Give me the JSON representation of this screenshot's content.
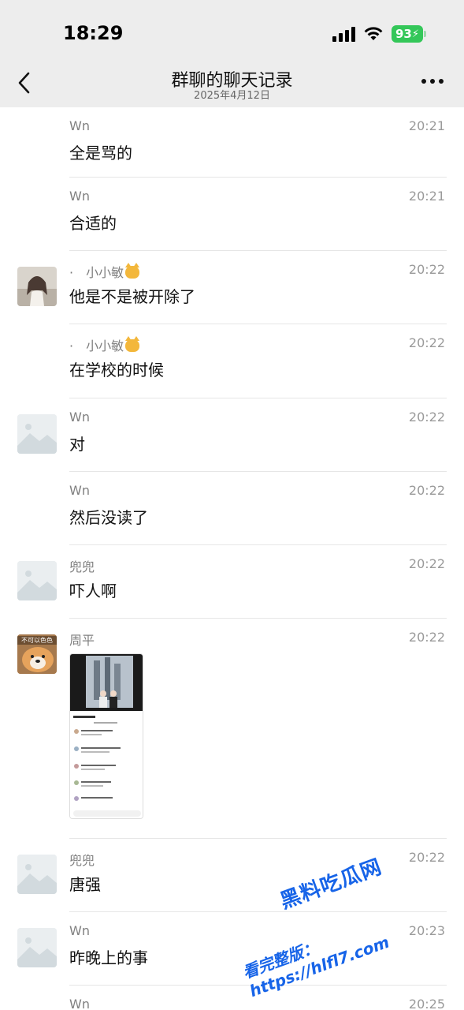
{
  "status_bar": {
    "time": "18:29",
    "battery": "93"
  },
  "nav": {
    "title": "群聊的聊天记录",
    "subtitle": "2025年4月12日"
  },
  "messages": [
    {
      "sender": "Wn",
      "time": "20:21",
      "text": "全是骂的",
      "avatar": "none"
    },
    {
      "sender": "Wn",
      "time": "20:21",
      "text": "合适的",
      "avatar": "none"
    },
    {
      "sender": "小小敏",
      "time": "20:22",
      "text": "他是不是被开除了",
      "avatar": "photo-girl",
      "prefix": "·"
    },
    {
      "sender": "小小敏",
      "time": "20:22",
      "text": "在学校的时候",
      "avatar": "none",
      "prefix": "·"
    },
    {
      "sender": "Wn",
      "time": "20:22",
      "text": "对",
      "avatar": "placeholder"
    },
    {
      "sender": "Wn",
      "time": "20:22",
      "text": "然后没读了",
      "avatar": "none"
    },
    {
      "sender": "兜兜",
      "time": "20:22",
      "text": "吓人啊",
      "avatar": "placeholder"
    },
    {
      "sender": "周平",
      "time": "20:22",
      "text": "",
      "avatar": "photo-dog",
      "avatar_caption": "不可以色色",
      "attachment": "screenshot-image"
    },
    {
      "sender": "兜兜",
      "time": "20:22",
      "text": "唐强",
      "avatar": "placeholder"
    },
    {
      "sender": "Wn",
      "time": "20:23",
      "text": "昨晚上的事",
      "avatar": "placeholder"
    },
    {
      "sender": "Wn",
      "time": "20:25",
      "text": "",
      "avatar": "none"
    }
  ],
  "watermark": {
    "line1": "黑料吃瓜网",
    "line2": "看完整版：https://hlfl7.com"
  },
  "colors": {
    "header_bg": "#ededed",
    "battery_green": "#34c759",
    "watermark_blue": "#1764e8"
  }
}
